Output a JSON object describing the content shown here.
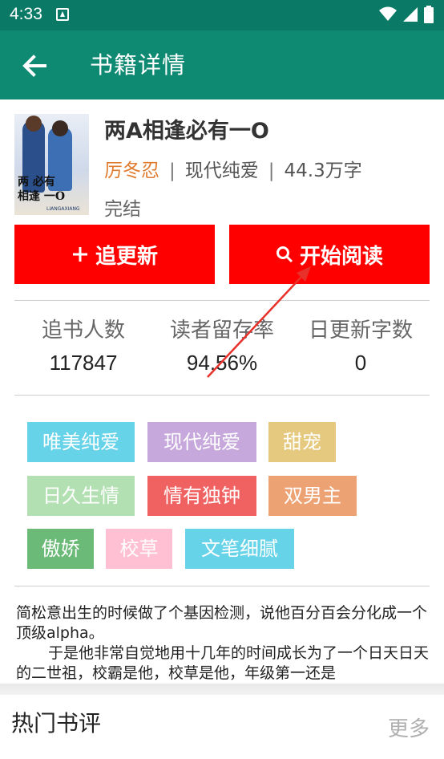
{
  "status_bar": {
    "time": "4:33",
    "wifi_icon": "wifi-icon",
    "signal_icon": "signal-icon",
    "battery_icon": "battery-icon"
  },
  "app_bar": {
    "title": "书籍详情",
    "back_icon": "arrow-left-icon"
  },
  "book": {
    "title": "两A相逢必有一O",
    "author": "厉冬忍",
    "separator": "|",
    "category": "现代纯爱",
    "word_count": "44.3万字",
    "status": "完结",
    "cover_text_line1": "两 必有",
    "cover_text_line2": "相逢 一O",
    "cover_sub": "LIANGAXIANG"
  },
  "actions": {
    "follow_label": "追更新",
    "read_label": "开始阅读"
  },
  "stats": [
    {
      "label": "追书人数",
      "value": "117847"
    },
    {
      "label": "读者留存率",
      "value": "94.56%"
    },
    {
      "label": "日更新字数",
      "value": "0"
    }
  ],
  "tags": [
    {
      "label": "唯美纯爱",
      "color": "#66d3e8"
    },
    {
      "label": "现代纯爱",
      "color": "#c7a8dc"
    },
    {
      "label": "甜宠",
      "color": "#e5c97f"
    },
    {
      "label": "日久生情",
      "color": "#b2e0b2"
    },
    {
      "label": "情有独钟",
      "color": "#f06262"
    },
    {
      "label": "双男主",
      "color": "#eda274"
    },
    {
      "label": "傲娇",
      "color": "#6cba77"
    },
    {
      "label": "校草",
      "color": "#ffc0d3"
    },
    {
      "label": "文笔细腻",
      "color": "#66d3e8"
    }
  ],
  "description": {
    "para1": "简松意出生的时候做了个基因检测，说他百分百会分化成一个顶级alpha。",
    "para2": "于是他非常自觉地用十几年的时间成长为了一个日天日天的二世祖，校霸是他，校草是他，年级第一还是"
  },
  "reviews": {
    "title": "热门书评",
    "more_label": "更多"
  },
  "colors": {
    "status_bar": "#0a7a67",
    "app_bar": "#0e8a73",
    "button_red": "#ff0000",
    "author_orange": "#e07b2d",
    "annotation_red": "#e8312a"
  }
}
